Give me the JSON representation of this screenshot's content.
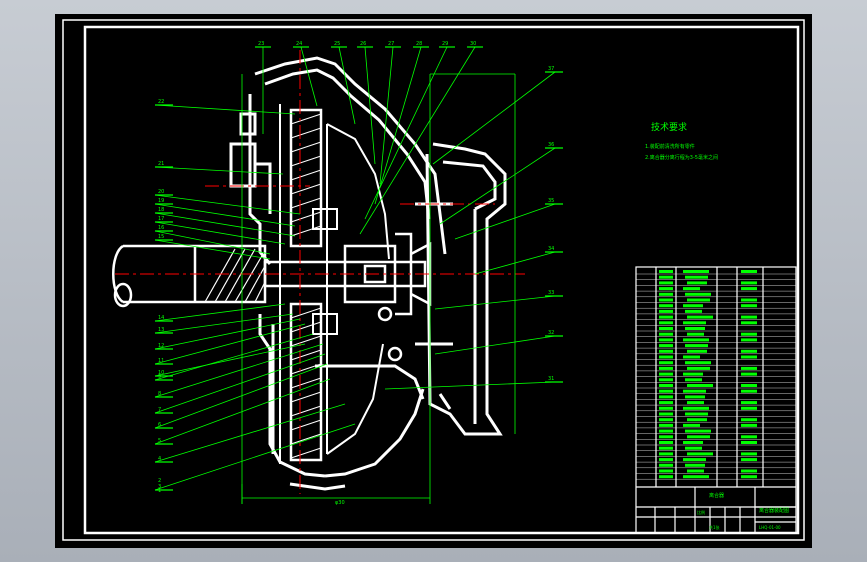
{
  "drawing": {
    "tech_requirements": {
      "title": "技术要求",
      "lines": [
        "1.装配前清洗所有零件",
        "2.离合器分离行程为3-5毫米之间"
      ]
    },
    "part_callouts_left": [
      "22",
      "21",
      "20",
      "19",
      "18",
      "17",
      "16",
      "15",
      "14",
      "13",
      "12",
      "11",
      "10",
      "9",
      "8",
      "7",
      "6",
      "5",
      "4",
      "3",
      "2",
      "1"
    ],
    "part_callouts_top": [
      "23",
      "24",
      "25",
      "26",
      "27",
      "28",
      "29",
      "30"
    ],
    "part_callouts_right": [
      "37",
      "36",
      "35",
      "34",
      "33",
      "32",
      "31"
    ],
    "dimension_label": "φ30",
    "title_block": {
      "material_label": "离合器",
      "drawing_name": "离合器装配图",
      "drawing_number": "LHQ-01-00",
      "scale_label": "比例",
      "sheet_label": "共1张"
    },
    "colors": {
      "background": "#000000",
      "lines": "#ffffff",
      "annotation": "#00ff00",
      "section_fill": "#ffffff",
      "dim": "#ff0000"
    }
  }
}
